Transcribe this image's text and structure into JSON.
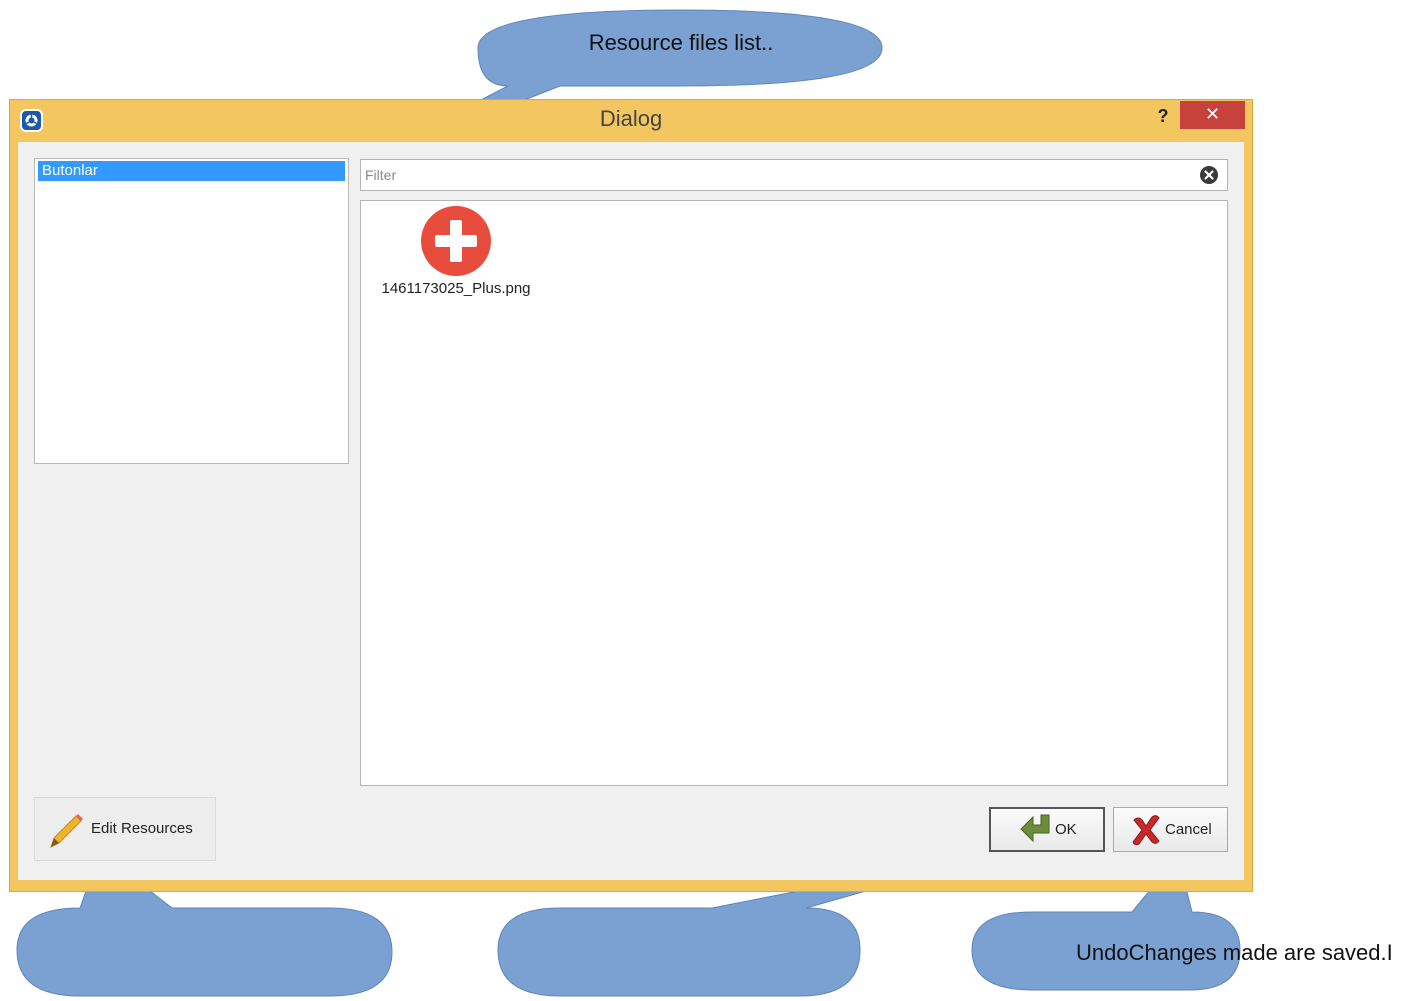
{
  "callouts": {
    "top_text": "Resource files list..",
    "bottom_right_text": "UndoChanges made are saved.I"
  },
  "dialog": {
    "title": "Dialog",
    "help_label": "?",
    "close_label": "✕"
  },
  "resource_list": {
    "items": [
      {
        "label": "Butonlar",
        "selected": true
      }
    ]
  },
  "filter": {
    "placeholder": "Filter",
    "value": ""
  },
  "files": [
    {
      "name": "1461173025_Plus.png",
      "icon": "plus-circle-icon"
    }
  ],
  "buttons": {
    "edit_resources": "Edit Resources",
    "ok": "OK",
    "cancel": "Cancel"
  },
  "colors": {
    "window_frame": "#f3c65f",
    "callout_fill": "#7aa1d2",
    "selection": "#3399ff",
    "close_red": "#c7423a",
    "plus_red": "#e84c3d"
  }
}
